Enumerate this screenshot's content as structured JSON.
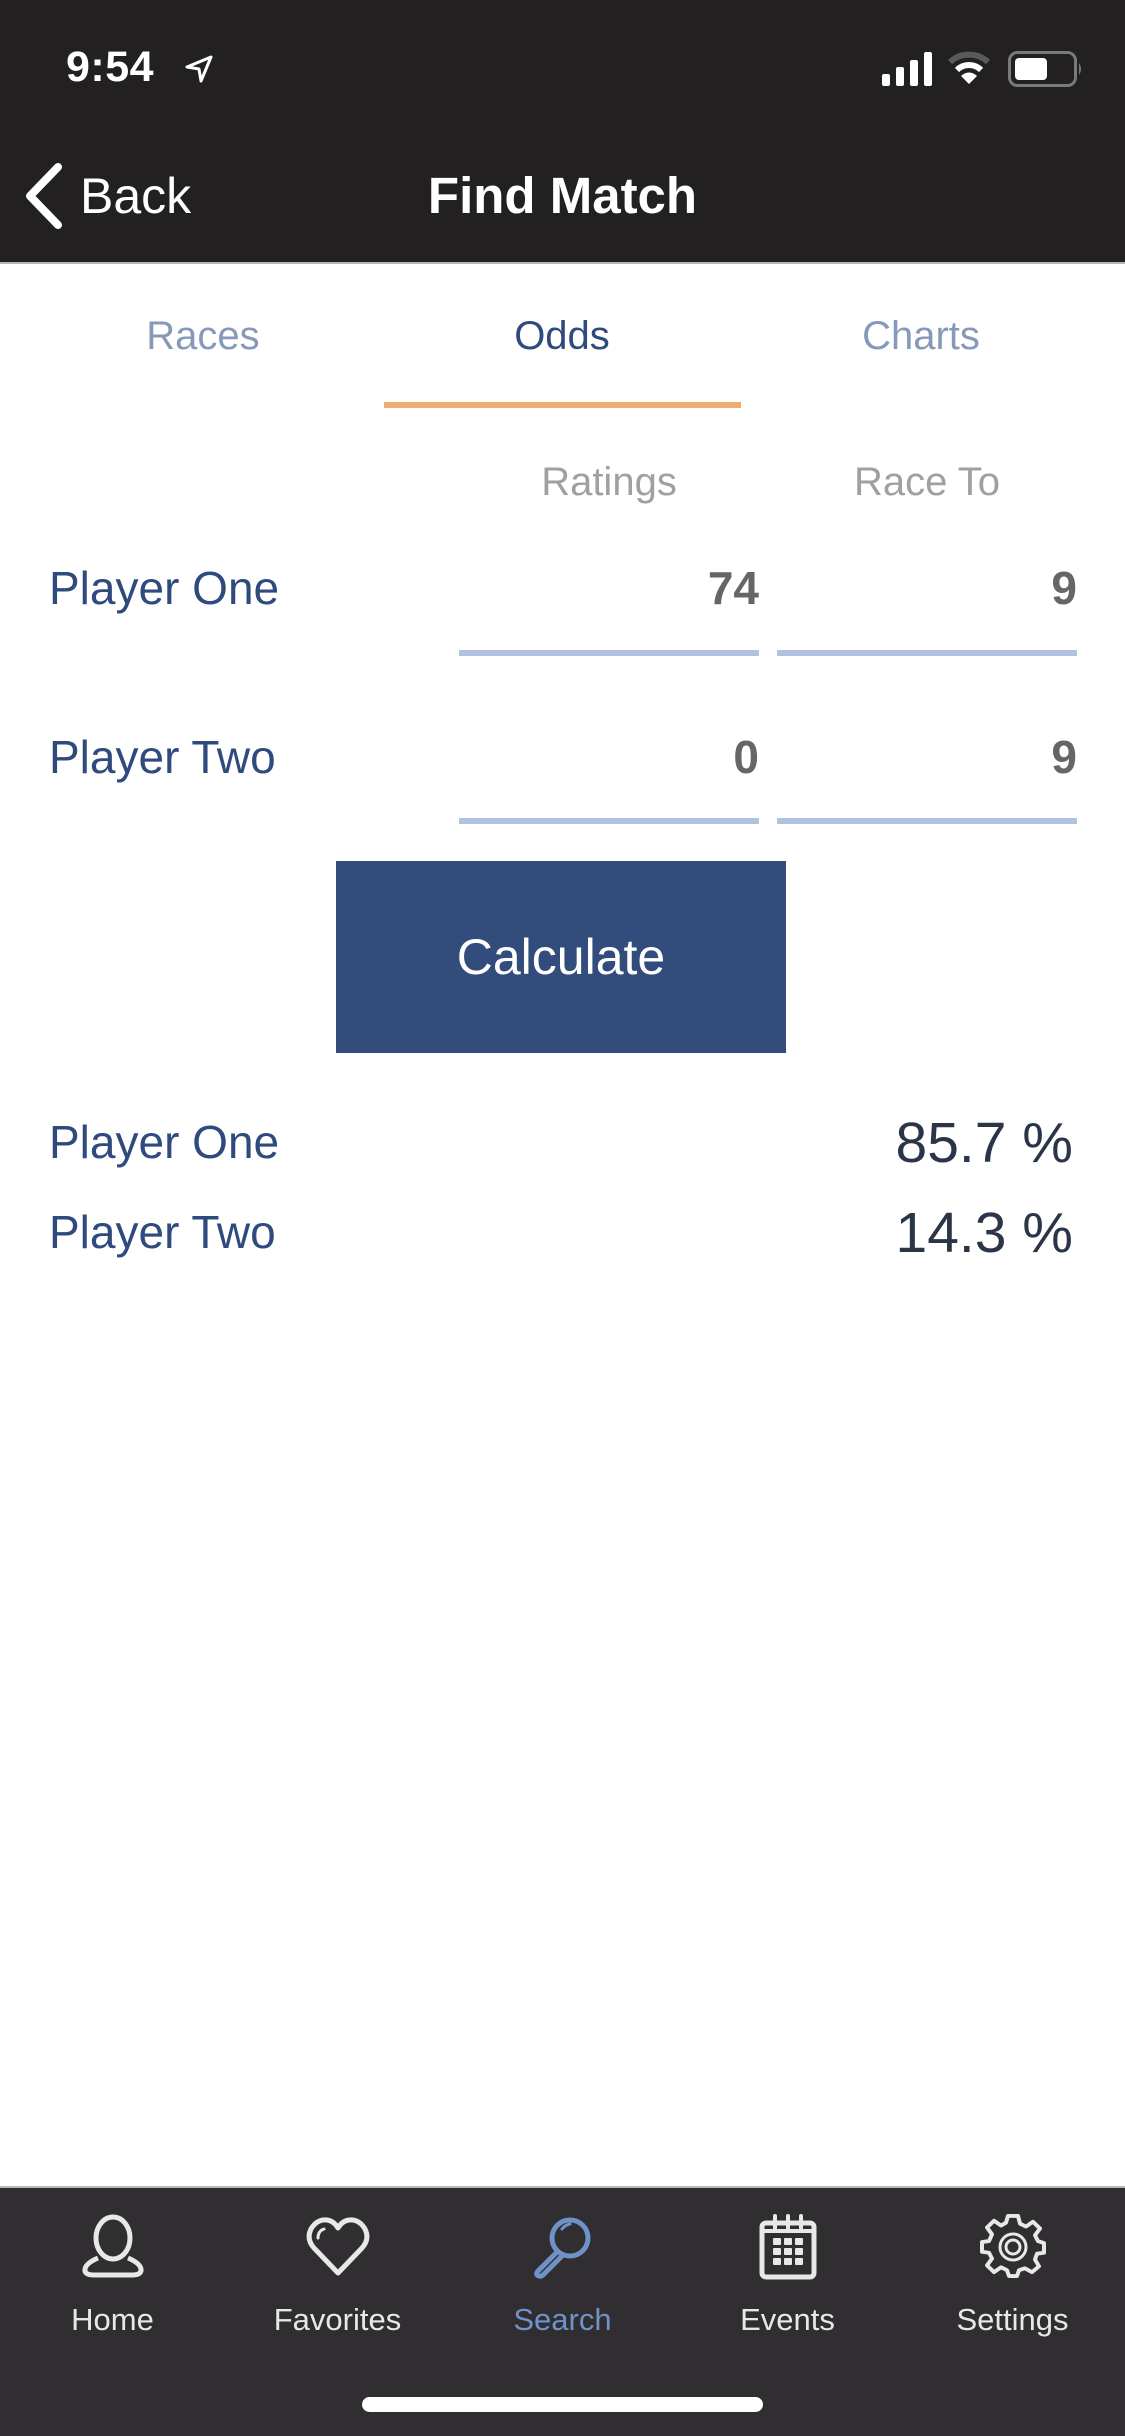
{
  "status_bar": {
    "time": "9:54",
    "icons": [
      "location-arrow-icon",
      "cellular-signal-icon",
      "wifi-icon",
      "battery-icon"
    ]
  },
  "nav": {
    "back_label": "Back",
    "title": "Find Match"
  },
  "segments": {
    "tabs": [
      {
        "label": "Races",
        "active": false
      },
      {
        "label": "Odds",
        "active": true
      },
      {
        "label": "Charts",
        "active": false
      }
    ]
  },
  "form": {
    "columns": [
      "Ratings",
      "Race To"
    ],
    "rows": [
      {
        "label": "Player One",
        "rating": "74",
        "race_to": "9"
      },
      {
        "label": "Player Two",
        "rating": "0",
        "race_to": "9"
      }
    ],
    "calculate_label": "Calculate"
  },
  "results": [
    {
      "label": "Player One",
      "value": "85.7 %"
    },
    {
      "label": "Player Two",
      "value": "14.3 %"
    }
  ],
  "tab_bar": {
    "items": [
      {
        "label": "Home",
        "icon": "person-icon",
        "active": false
      },
      {
        "label": "Favorites",
        "icon": "heart-icon",
        "active": false
      },
      {
        "label": "Search",
        "icon": "search-icon",
        "active": true
      },
      {
        "label": "Events",
        "icon": "calendar-icon",
        "active": false
      },
      {
        "label": "Settings",
        "icon": "gear-icon",
        "active": false
      }
    ]
  },
  "colors": {
    "header_bg": "#222021",
    "primary": "#2f4a7c",
    "button_bg": "#324c7c",
    "tab_inactive": "#8699b9",
    "tab_indicator": "#eeac72",
    "field_underline": "#b0c2df",
    "result_value": "#2a3648",
    "tabbar_bg": "#302e30",
    "tabbar_active": "#6f92c8"
  }
}
